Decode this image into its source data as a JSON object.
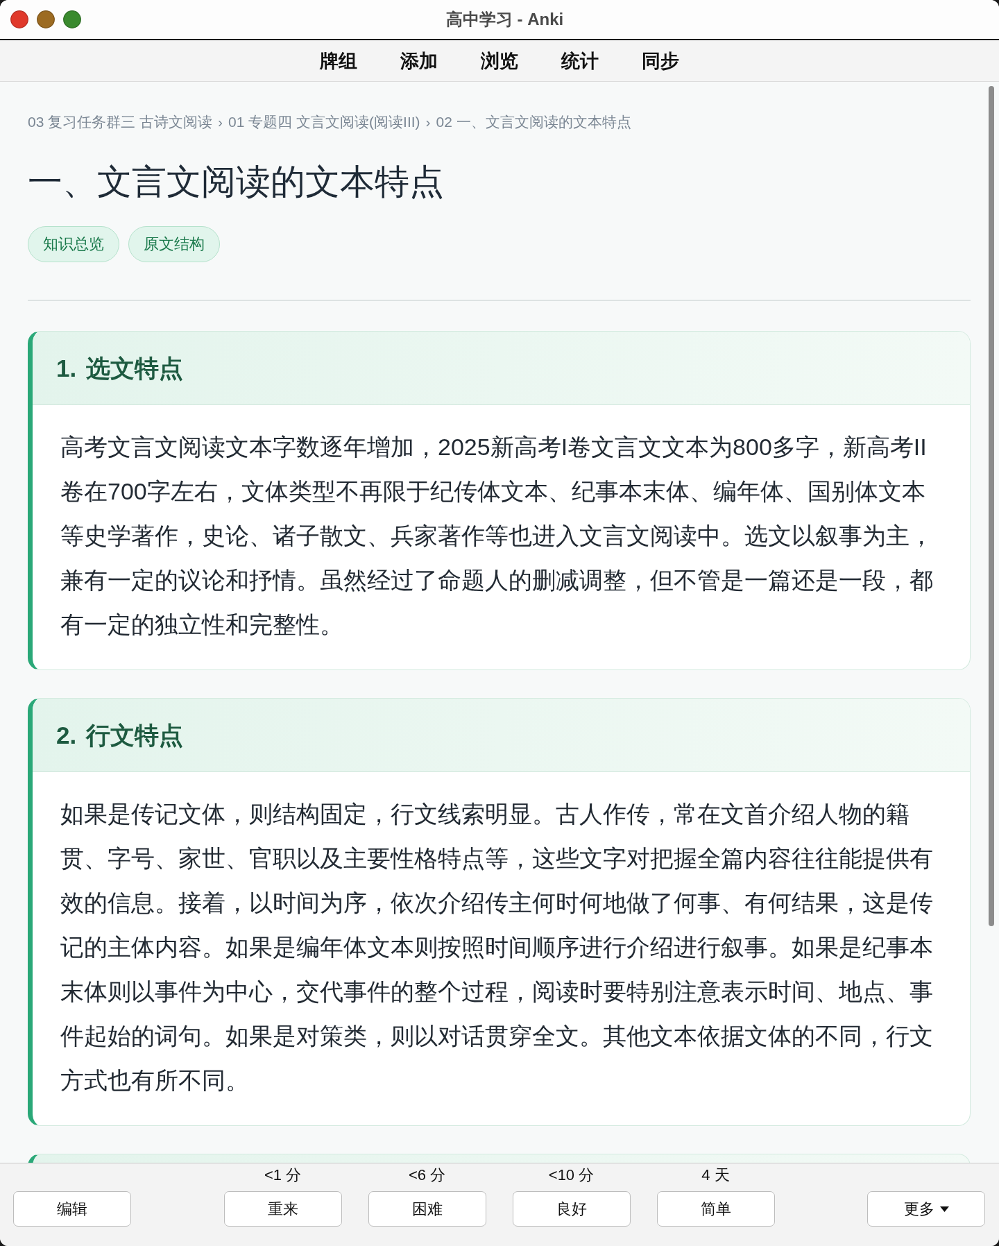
{
  "window": {
    "title": "高中学习 - Anki"
  },
  "toolbar": [
    "牌组",
    "添加",
    "浏览",
    "统计",
    "同步"
  ],
  "card": {
    "breadcrumb": {
      "items": [
        "03 复习任务群三 古诗文阅读",
        "01 专题四 文言文阅读(阅读III)",
        "02 一、文言文阅读的文本特点"
      ],
      "separator": "›"
    },
    "title": "一、文言文阅读的文本特点",
    "tags": [
      "知识总览",
      "原文结构"
    ],
    "sections": [
      {
        "number": "1.",
        "title": "选文特点",
        "text": "高考文言文阅读文本字数逐年增加，2025新高考I卷文言文文本为800多字，新高考II卷在700字左右，文体类型不再限于纪传体文本、纪事本末体、编年体、国别体文本等史学著作，史论、诸子散文、兵家著作等也进入文言文阅读中。选文以叙事为主，兼有一定的议论和抒情。虽然经过了命题人的删减调整，但不管是一篇还是一段，都有一定的独立性和完整性。"
      },
      {
        "number": "2.",
        "title": "行文特点",
        "text": "如果是传记文体，则结构固定，行文线索明显。古人作传，常在文首介绍人物的籍贯、字号、家世、官职以及主要性格特点等，这些文字对把握全篇内容往往能提供有效的信息。接着，以时间为序，依次介绍传主何时何地做了何事、有何结果，这是传记的主体内容。如果是编年体文本则按照时间顺序进行介绍进行叙事。如果是纪事本末体则以事件为中心，交代事件的整个过程，阅读时要特别注意表示时间、地点、事件起始的词句。如果是对策类，则以对话贯穿全文。其他文本依据文体的不同，行文方式也有所不同。"
      }
    ]
  },
  "answer_bar": {
    "edit_button": "编辑",
    "answers": [
      {
        "interval": "<1 分",
        "label": "重来"
      },
      {
        "interval": "<6 分",
        "label": "困难"
      },
      {
        "interval": "<10 分",
        "label": "良好"
      },
      {
        "interval": "4 天",
        "label": "简单"
      }
    ],
    "more_button": "更多"
  }
}
